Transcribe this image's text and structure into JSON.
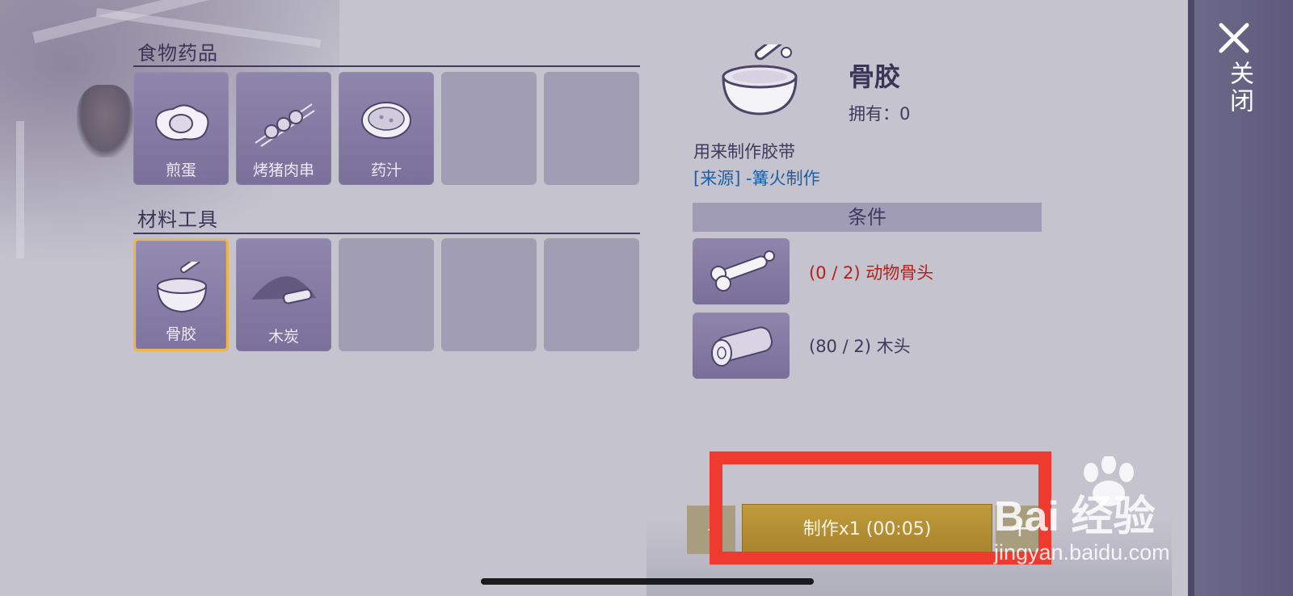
{
  "sections": [
    {
      "title": "食物药品",
      "items": [
        {
          "label": "煎蛋",
          "icon": "fried-egg-icon"
        },
        {
          "label": "烤猪肉串",
          "icon": "skewer-icon"
        },
        {
          "label": "药汁",
          "icon": "soup-bowl-icon"
        }
      ]
    },
    {
      "title": "材料工具",
      "items": [
        {
          "label": "骨胶",
          "icon": "mortar-bone-icon"
        },
        {
          "label": "木炭",
          "icon": "charcoal-icon"
        }
      ]
    }
  ],
  "detail": {
    "name": "骨胶",
    "owned": "拥有：0",
    "description": "用来制作胶带",
    "source": "[来源] -篝火制作",
    "conditions_header": "条件",
    "conditions": [
      {
        "text": "(0 / 2) 动物骨头",
        "icon": "bone-icon",
        "status": "missing"
      },
      {
        "text": "(80 / 2) 木头",
        "icon": "log-icon",
        "status": "ok"
      }
    ]
  },
  "actions": {
    "minus": "-",
    "craft": "制作x1 (00:05)",
    "plus": "+"
  },
  "side": {
    "close": "关闭"
  },
  "watermark": {
    "main": "Bai 经验",
    "sub": "jingyan.baidu.com"
  },
  "colors": {
    "selected_border": "#f0b640",
    "craft_button": "#b8923a",
    "missing_text": "#b3211b",
    "highlight": "#ef3a2f"
  }
}
